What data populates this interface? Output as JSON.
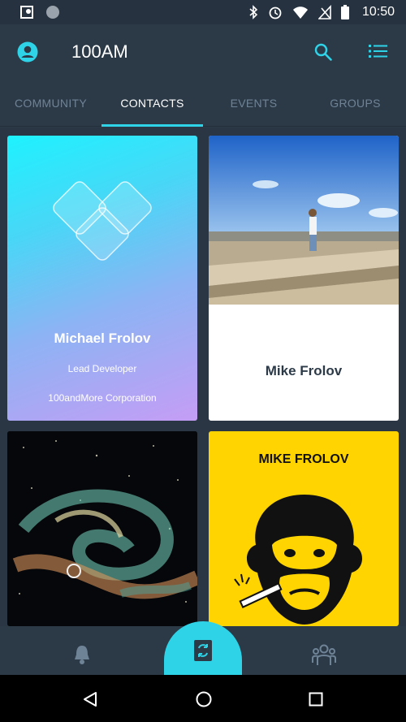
{
  "status_bar": {
    "time": "10:50",
    "icons": [
      "map-pin-icon",
      "circle-icon",
      "bluetooth-icon",
      "alarm-icon",
      "wifi-icon",
      "no-signal-icon",
      "battery-icon"
    ]
  },
  "app_bar": {
    "title": "100AM",
    "icons": [
      "account-icon",
      "search-icon",
      "list-icon"
    ]
  },
  "tabs": [
    {
      "label": "COMMUNITY",
      "active": false
    },
    {
      "label": "CONTACTS",
      "active": true
    },
    {
      "label": "EVENTS",
      "active": false
    },
    {
      "label": "GROUPS",
      "active": false
    }
  ],
  "cards": [
    {
      "name": "Michael Frolov",
      "role": "Lead Developer",
      "company": "100andMore Corporation"
    },
    {
      "name": "Mike Frolov"
    },
    {},
    {
      "name": "MIKE FROLOV"
    }
  ],
  "bottom_bar": {
    "icons": [
      "bell-icon",
      "swap-icon",
      "group-icon"
    ]
  },
  "nav_bar": {
    "icons": [
      "back-icon",
      "home-icon",
      "recents-icon"
    ]
  },
  "colors": {
    "accent": "#2fd3e8",
    "background": "#2c3a48",
    "card_yellow": "#ffd400"
  }
}
